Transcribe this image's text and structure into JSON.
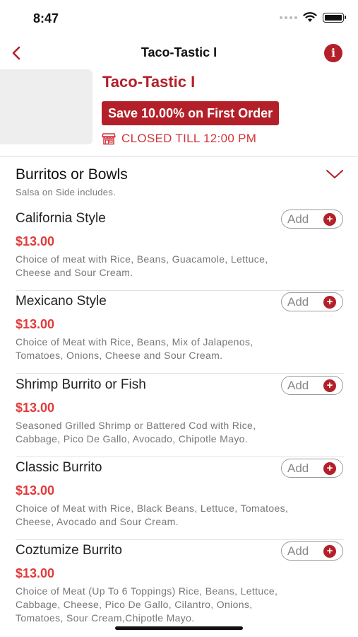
{
  "status_bar": {
    "time": "8:47"
  },
  "nav": {
    "title": "Taco-Tastic I",
    "back_icon": "chevron-left-icon",
    "info_icon": "info-icon",
    "info_glyph": "i"
  },
  "store": {
    "name": "Taco-Tastic I",
    "promo": "Save 10.00% on First Order",
    "status": "CLOSED TILL 12:00 PM",
    "accent_color": "#b42029"
  },
  "category": {
    "title": "Burritos or Bowls",
    "subtitle": "Salsa on Side includes."
  },
  "add_label": "Add",
  "add_glyph": "+",
  "items": [
    {
      "name": "California Style",
      "price": "$13.00",
      "desc_lines": [
        "Choice of meat with Rice, Beans, Guacamole, Lettuce,",
        "Cheese and Sour Cream."
      ]
    },
    {
      "name": "Mexicano Style",
      "price": "$13.00",
      "desc_lines": [
        "Choice of Meat with Rice, Beans, Mix of Jalapenos,",
        "Tomatoes, Onions, Cheese and Sour Cream."
      ]
    },
    {
      "name": "Shrimp Burrito or Fish",
      "price": "$13.00",
      "desc_lines": [
        "Seasoned Grilled Shrimp or Battered Cod with Rice,",
        "Cabbage, Pico De Gallo, Avocado, Chipotle Mayo."
      ]
    },
    {
      "name": "Classic Burrito",
      "price": "$13.00",
      "desc_lines": [
        "Choice of Meat with Rice, Black Beans, Lettuce, Tomatoes,",
        "Cheese, Avocado and Sour Cream."
      ]
    },
    {
      "name": "Coztumize Burrito",
      "price": "$13.00",
      "desc_lines": [
        "Choice of Meat (Up To 6 Toppings) Rice, Beans, Lettuce,",
        "Cabbage, Cheese, Pico De Gallo, Cilantro, Onions,",
        "Tomatoes, Sour Cream,Chipotle Mayo."
      ]
    }
  ]
}
